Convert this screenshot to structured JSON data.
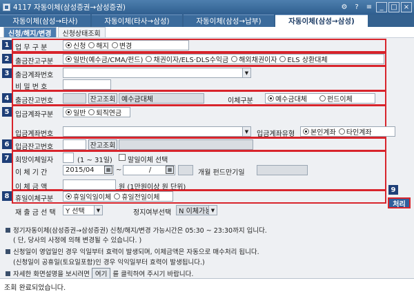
{
  "window": {
    "title": "4117 자동이체(삼성증권→삼성증권)",
    "buttons": [
      "⚙",
      "?",
      "≡",
      "_",
      "□",
      "×"
    ]
  },
  "tabs": [
    {
      "label": "자동이체(삼성→타사)",
      "active": false
    },
    {
      "label": "자동이체(타사→삼성)",
      "active": false
    },
    {
      "label": "자동이체(삼성→납부)",
      "active": false
    },
    {
      "label": "자동이체(삼성→삼성)",
      "active": true
    }
  ],
  "subtabs": [
    {
      "label": "신청/해지/변경",
      "active": true
    },
    {
      "label": "신청상태조회",
      "active": false
    }
  ],
  "section1": {
    "num": "1",
    "label": "업 무 구 분",
    "options": [
      {
        "label": "신청",
        "selected": true
      },
      {
        "label": "해지",
        "selected": false
      },
      {
        "label": "변경",
        "selected": false
      }
    ]
  },
  "section2": {
    "num": "2",
    "label": "출금잔고구분",
    "options": [
      {
        "label": "일반(예수금/CMA/펀드)",
        "selected": true
      },
      {
        "label": "채권이자/ELS·DLS수익금",
        "selected": false
      },
      {
        "label": "해외채권이자",
        "selected": false
      },
      {
        "label": "ELS 상환대체",
        "selected": false
      }
    ]
  },
  "section3": {
    "num": "3",
    "account_label": "출금계좌번호",
    "account_value": "",
    "password_label": "비 밀 번 호",
    "password_value": ""
  },
  "section4": {
    "num": "4",
    "label": "출금잔고번호",
    "value": "",
    "query_button": "잔고조회",
    "name_value": "예수금대체",
    "transfer_type_label": "이체구분",
    "options": [
      {
        "label": "예수금대체",
        "selected": true
      },
      {
        "label": "펀드이체",
        "selected": false
      }
    ]
  },
  "section5": {
    "num": "5",
    "label": "입금계좌구분",
    "options": [
      {
        "label": "일반",
        "selected": true
      },
      {
        "label": "퇴직연금",
        "selected": false
      }
    ],
    "account_label": "입금계좌번호",
    "account_value": "",
    "account_type_label": "입금계좌유형",
    "account_type_options": [
      {
        "label": "본인계좌",
        "selected": true
      },
      {
        "label": "타인계좌",
        "selected": false
      }
    ]
  },
  "section6": {
    "num": "6",
    "label": "입금잔고번호",
    "value": "",
    "query_button": "잔고조회",
    "name_value": ""
  },
  "section7": {
    "num": "7",
    "day_label": "회망이체일자",
    "day_value": "",
    "day_range": "(1 ~ 31일)",
    "month_end_label": "말일이체 선택",
    "month_end_checked": false,
    "period_label": "이 체 기 간",
    "period_start": "2015/04",
    "period_sep": "~",
    "period_end": "/",
    "fund_maturity_label": "개월  펀드만기일",
    "amount_label": "이 체 금 액",
    "amount_value": "",
    "amount_unit": "원 (1만원이상 원 단위)"
  },
  "section8": {
    "num": "8",
    "label": "휴일이체구분",
    "options": [
      {
        "label": "휴일익일이체",
        "selected": true
      },
      {
        "label": "휴일전일이체",
        "selected": false
      }
    ]
  },
  "reorder": {
    "label": "재 출 금 선 택",
    "value": "Y 선택",
    "stop_label": "정지여부선택",
    "stop_value": "N 이체가능"
  },
  "process": {
    "num": "9",
    "button": "처리"
  },
  "notes": [
    "정기자동이체(삼성증권→삼성증권) 신청/해지/변경 가능시간은 05:30 ~ 23:30까지 입니다.",
    "( 단, 당사의 사정에 의해 변경될 수 있습니다. )",
    "신청일이 영업일인 경우 익일부터 효력이  발생되며, 이체금액은 자동으로 매수처리 됩니다.",
    "(신청일이 공휴일(토요일포함)인  경우  익익일부터 효력이 발생됩니다.)",
    "자세한 화면설명을 보시려면",
    "여기",
    "를 클릭하여 주시기 바랍니다."
  ],
  "status": "조회 완료되었습니다."
}
